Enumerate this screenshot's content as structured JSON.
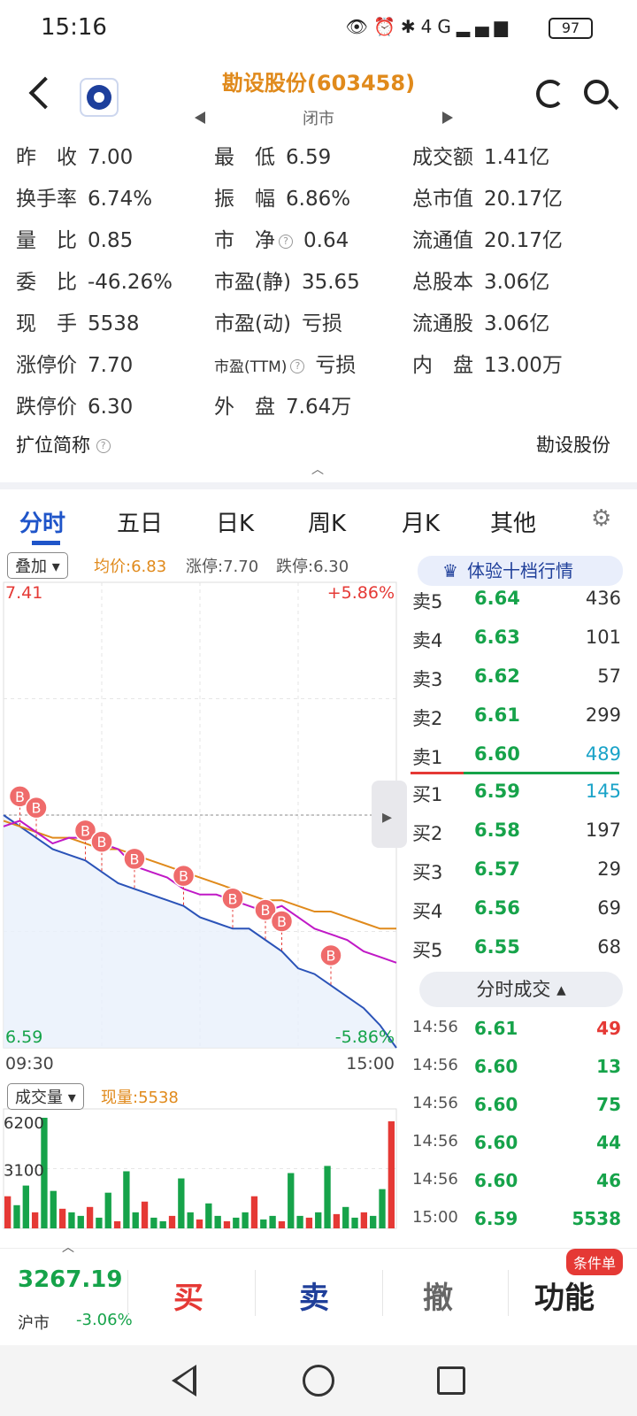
{
  "status": {
    "time": "15:16",
    "battery": "97",
    "network": "4G"
  },
  "header": {
    "title": "勘设股份(603458)",
    "subtitle": "闭市"
  },
  "info_rows": [
    [
      {
        "label": "昨　收",
        "value": "7.00"
      },
      {
        "label": "最　低",
        "value": "6.59"
      },
      {
        "label": "成交额",
        "value": "1.41亿"
      }
    ],
    [
      {
        "label": "换手率",
        "value": "6.74%"
      },
      {
        "label": "振　幅",
        "value": "6.86%"
      },
      {
        "label": "总市值",
        "value": "20.17亿"
      }
    ],
    [
      {
        "label": "量　比",
        "value": "0.85"
      },
      {
        "label": "市　净",
        "value": "0.64"
      },
      {
        "label": "流通值",
        "value": "20.17亿"
      }
    ],
    [
      {
        "label": "委　比",
        "value": "-46.26%"
      },
      {
        "label": "市盈(静)",
        "value": "35.65"
      },
      {
        "label": "总股本",
        "value": "3.06亿"
      }
    ],
    [
      {
        "label": "现　手",
        "value": "5538"
      },
      {
        "label": "市盈(动)",
        "value": "亏损"
      },
      {
        "label": "流通股",
        "value": "3.06亿"
      }
    ],
    [
      {
        "label": "涨停价",
        "value": "7.70"
      },
      {
        "label": "市盈(TTM)",
        "value": "亏损"
      },
      {
        "label": "内　盘",
        "value": "13.00万"
      }
    ],
    [
      {
        "label": "跌停价",
        "value": "6.30"
      },
      {
        "label": "外　盘",
        "value": "7.64万"
      },
      {
        "label": "",
        "value": ""
      }
    ]
  ],
  "short_name": {
    "label": "扩位简称",
    "value": "勘设股份"
  },
  "tabs": [
    "分时",
    "五日",
    "日K",
    "周K",
    "月K",
    "其他"
  ],
  "chart_overlay": {
    "overlay_label": "叠加",
    "avg_price": "均价:6.83",
    "limit_up": "涨停:7.70",
    "limit_down": "跌停:6.30"
  },
  "chart_data": {
    "type": "line",
    "title": "",
    "y_top": "7.41",
    "y_bottom": "6.59",
    "pct_top": "+5.86%",
    "pct_bottom": "-5.86%",
    "x_start": "09:30",
    "x_end": "15:00",
    "ylim": [
      6.59,
      7.41
    ],
    "prev_close": 7.0,
    "series": [
      {
        "values": [
          7.0,
          6.98,
          6.96,
          6.94,
          6.93,
          6.92,
          6.9,
          6.88,
          6.87,
          6.86,
          6.85,
          6.84,
          6.82,
          6.81,
          6.8,
          6.8,
          6.78,
          6.76,
          6.73,
          6.72,
          6.7,
          6.68,
          6.66,
          6.63,
          6.59
        ]
      },
      {
        "values": [
          6.99,
          6.98,
          6.97,
          6.96,
          6.96,
          6.95,
          6.94,
          6.94,
          6.93,
          6.92,
          6.91,
          6.9,
          6.89,
          6.88,
          6.87,
          6.86,
          6.85,
          6.85,
          6.84,
          6.83,
          6.83,
          6.82,
          6.81,
          6.8,
          6.8
        ]
      },
      {
        "values": [
          6.98,
          6.99,
          6.97,
          6.95,
          6.96,
          6.96,
          6.95,
          6.94,
          6.91,
          6.9,
          6.89,
          6.87,
          6.86,
          6.86,
          6.85,
          6.84,
          6.83,
          6.84,
          6.82,
          6.8,
          6.79,
          6.78,
          6.76,
          6.75,
          6.74
        ]
      }
    ],
    "markers": [
      "B",
      "B",
      "B",
      "B",
      "B",
      "B",
      "B",
      "B",
      "B",
      "B"
    ],
    "volume_label": "成交量",
    "current_volume": "现量:5538",
    "volume_ticks": [
      "6200",
      "3100"
    ],
    "volume_values": [
      1800,
      1300,
      2400,
      900,
      6200,
      2100,
      1100,
      900,
      700,
      1200,
      600,
      2000,
      400,
      3200,
      900,
      1500,
      600,
      400,
      700,
      2800,
      900,
      500,
      1400,
      700,
      400,
      600,
      900,
      1800,
      500,
      700,
      400,
      3100,
      700,
      600,
      900,
      3500,
      800,
      1200,
      600,
      900,
      700,
      2200,
      6000
    ]
  },
  "book": {
    "experience": "体验十档行情",
    "asks": [
      {
        "label": "卖5",
        "price": "6.64",
        "vol": "436"
      },
      {
        "label": "卖4",
        "price": "6.63",
        "vol": "101"
      },
      {
        "label": "卖3",
        "price": "6.62",
        "vol": "57"
      },
      {
        "label": "卖2",
        "price": "6.61",
        "vol": "299"
      },
      {
        "label": "卖1",
        "price": "6.60",
        "vol": "489"
      }
    ],
    "bids": [
      {
        "label": "买1",
        "price": "6.59",
        "vol": "145"
      },
      {
        "label": "买2",
        "price": "6.58",
        "vol": "197"
      },
      {
        "label": "买3",
        "price": "6.57",
        "vol": "29"
      },
      {
        "label": "买4",
        "price": "6.56",
        "vol": "69"
      },
      {
        "label": "买5",
        "price": "6.55",
        "vol": "68"
      }
    ],
    "trades_title": "分时成交",
    "trades": [
      {
        "time": "14:56",
        "price": "6.61",
        "vol": "49",
        "dir": "up"
      },
      {
        "time": "14:56",
        "price": "6.60",
        "vol": "13",
        "dir": "down"
      },
      {
        "time": "14:56",
        "price": "6.60",
        "vol": "75",
        "dir": "down"
      },
      {
        "time": "14:56",
        "price": "6.60",
        "vol": "44",
        "dir": "down"
      },
      {
        "time": "14:56",
        "price": "6.60",
        "vol": "46",
        "dir": "down"
      },
      {
        "time": "15:00",
        "price": "6.59",
        "vol": "5538",
        "dir": "down"
      }
    ]
  },
  "bottom": {
    "index_value": "3267.19",
    "index_name": "沪市",
    "index_change": "-3.06%",
    "buy": "买",
    "sell": "卖",
    "cancel": "撤",
    "func": "功能",
    "badge": "条件单"
  },
  "colors": {
    "accent": "#1f55c9",
    "up": "#e53935",
    "down": "#16a34a",
    "avg": "#e08a1c",
    "price_line": "#2b53b8",
    "purple": "#c019c6"
  }
}
